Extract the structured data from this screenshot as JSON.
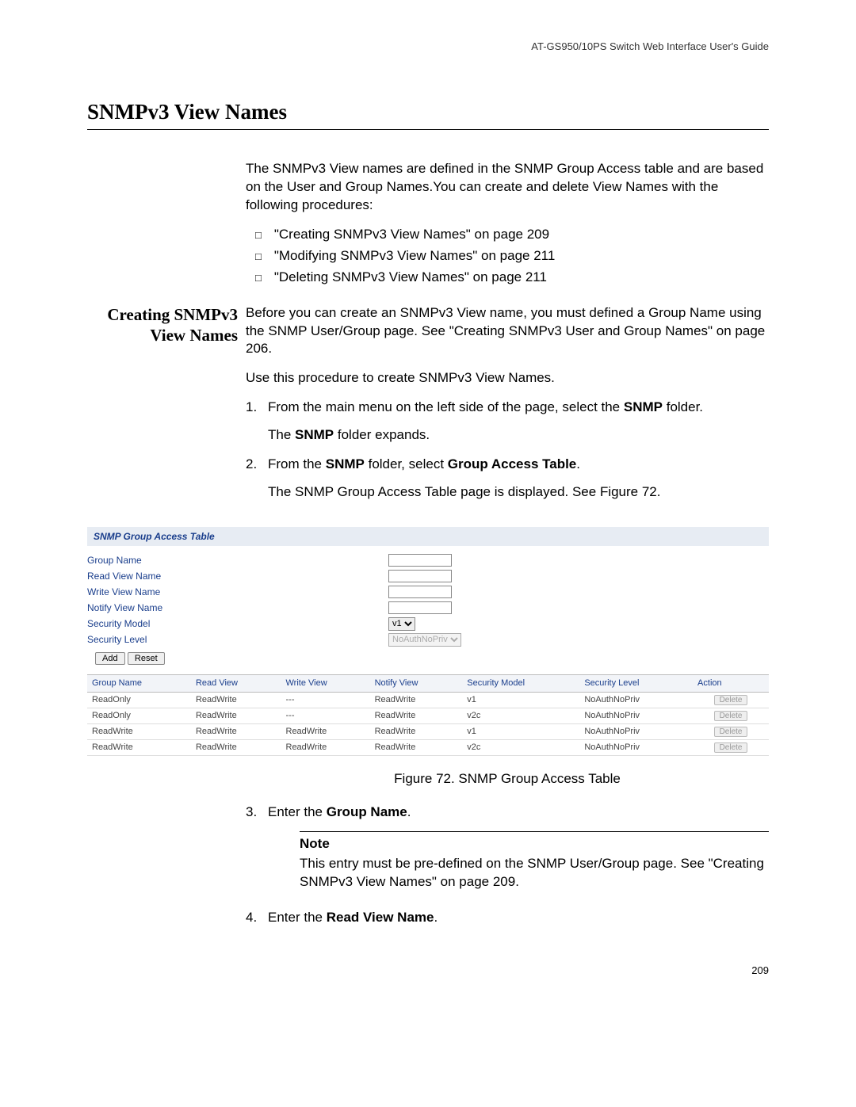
{
  "header_guide": "AT-GS950/10PS Switch Web Interface User's Guide",
  "chapter_title": "SNMPv3 View Names",
  "intro": "The SNMPv3 View names are defined in the SNMP Group Access table and are based on the User and Group Names.You can create and delete View Names with the following procedures:",
  "bullets": [
    "\"Creating SNMPv3 View Names\" on page 209",
    "\"Modifying SNMPv3 View Names\" on page 211",
    "\"Deleting SNMPv3 View Names\" on page 211"
  ],
  "side_heading": "Creating SNMPv3 View Names",
  "p_before": "Before you can create an SNMPv3 View name, you must defined a Group Name using the SNMP User/Group page. See \"Creating SNMPv3 User and Group Names\" on page 206.",
  "p_useproc": "Use this procedure to create SNMPv3 View Names.",
  "step1_pre": "From the main menu on the left side of the page, select the ",
  "step1_bold": "SNMP",
  "step1_post": " folder.",
  "step1b_pre": "The ",
  "step1b_bold": "SNMP",
  "step1b_post": " folder expands.",
  "step2_pre": "From the ",
  "step2_b1": "SNMP",
  "step2_mid": " folder, select ",
  "step2_b2": "Group Access Table",
  "step2_post": ".",
  "step2_result": "The SNMP Group Access Table page is displayed. See Figure 72.",
  "shot": {
    "title": "SNMP Group Access Table",
    "labels": {
      "group": "Group Name",
      "read": "Read View Name",
      "write": "Write View Name",
      "notify": "Notify View Name",
      "model": "Security Model",
      "level": "Security Level"
    },
    "model_value": "v1",
    "level_value": "NoAuthNoPriv",
    "add": "Add",
    "reset": "Reset",
    "cols": [
      "Group Name",
      "Read View",
      "Write View",
      "Notify View",
      "Security Model",
      "Security Level",
      "Action"
    ],
    "rows": [
      [
        "ReadOnly",
        "ReadWrite",
        "---",
        "ReadWrite",
        "v1",
        "NoAuthNoPriv"
      ],
      [
        "ReadOnly",
        "ReadWrite",
        "---",
        "ReadWrite",
        "v2c",
        "NoAuthNoPriv"
      ],
      [
        "ReadWrite",
        "ReadWrite",
        "ReadWrite",
        "ReadWrite",
        "v1",
        "NoAuthNoPriv"
      ],
      [
        "ReadWrite",
        "ReadWrite",
        "ReadWrite",
        "ReadWrite",
        "v2c",
        "NoAuthNoPriv"
      ]
    ],
    "delete": "Delete"
  },
  "fig_caption": "Figure 72. SNMP Group Access Table",
  "step3_pre": "Enter the ",
  "step3_bold": "Group Name",
  "step3_post": ".",
  "note_hdr": "Note",
  "note_body": "This entry must be pre-defined on the SNMP User/Group page. See \"Creating SNMPv3 View Names\" on page 209.",
  "step4_pre": "Enter the ",
  "step4_bold": "Read View Name",
  "step4_post": ".",
  "page_number": "209"
}
